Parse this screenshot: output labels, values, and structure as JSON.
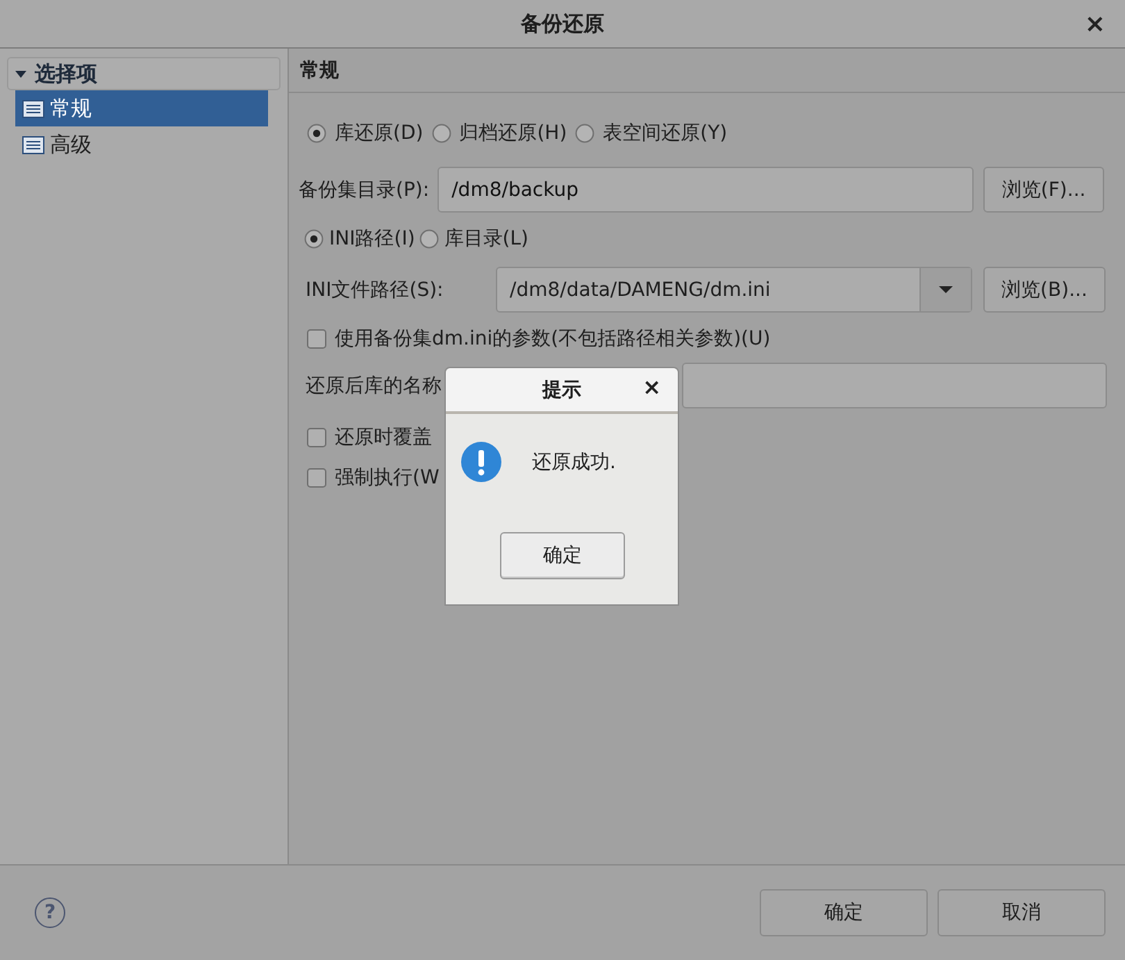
{
  "window": {
    "title": "备份还原",
    "close": "×"
  },
  "sidebar": {
    "header": "选择项",
    "expanded": true,
    "items": [
      {
        "label": "常规",
        "selected": true
      },
      {
        "label": "高级",
        "selected": false
      }
    ]
  },
  "panel": {
    "title": "常规",
    "restore_types": [
      {
        "label": "库还原(D)",
        "selected": true
      },
      {
        "label": "归档还原(H)",
        "selected": false
      },
      {
        "label": "表空间还原(Y)",
        "selected": false
      }
    ],
    "backup_dir": {
      "label": "备份集目录(P):",
      "value": "/dm8/backup",
      "button": "浏览(F)..."
    },
    "path_modes": [
      {
        "label": "INI路径(I)",
        "selected": true
      },
      {
        "label": "库目录(L)",
        "selected": false
      }
    ],
    "ini_path": {
      "label": "INI文件路径(S):",
      "value": "/dm8/data/DAMENG/dm.ini",
      "button": "浏览(B)..."
    },
    "use_backup_ini": {
      "label": "使用备份集dm.ini的参数(不包括路径相关参数)(U)",
      "checked": false
    },
    "db_name": {
      "label": "还原后库的名称"
    },
    "options": [
      {
        "label": "还原时覆盖",
        "checked": false
      },
      {
        "label": "强制执行(W",
        "checked": false
      }
    ]
  },
  "footer": {
    "help": "?",
    "buttons": [
      "确定",
      "取消"
    ]
  },
  "message": {
    "title": "提示",
    "close": "×",
    "text": "还原成功.",
    "button": "确定"
  }
}
